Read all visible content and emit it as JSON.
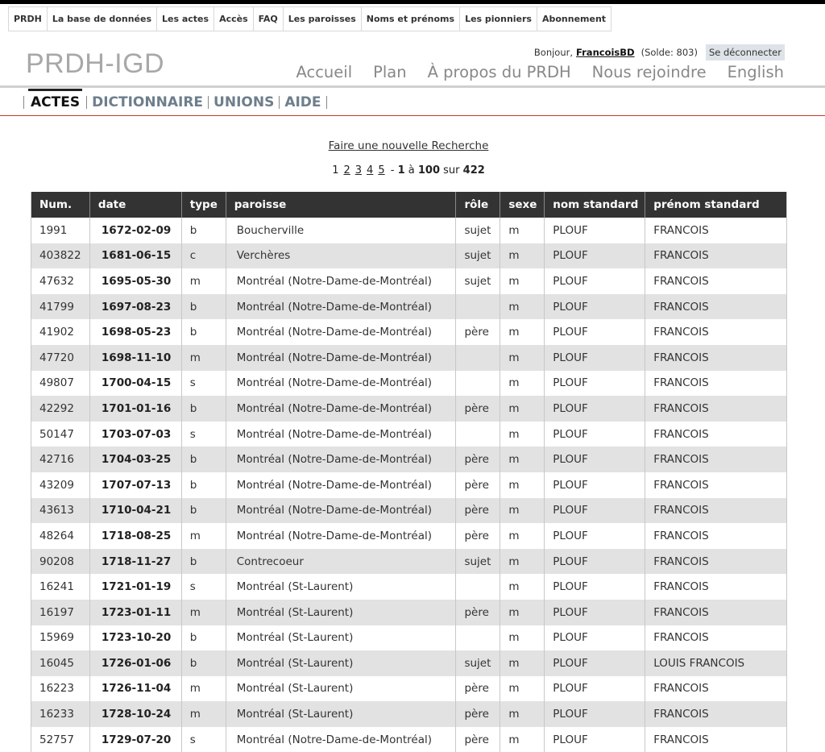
{
  "topnav": [
    "PRDH",
    "La base de données",
    "Les actes",
    "Accès",
    "FAQ",
    "Les paroisses",
    "Noms et prénoms",
    "Les pionniers",
    "Abonnement"
  ],
  "logo": "PRDH-IGD",
  "user": {
    "greeting": "Bonjour,",
    "username": "FrancoisBD",
    "balance": "(Solde: 803)",
    "logout": "Se déconnecter"
  },
  "mainnav": [
    "Accueil",
    "Plan",
    "À propos du PRDH",
    "Nous rejoindre",
    "English"
  ],
  "subnav": [
    "ACTES",
    "DICTIONNAIRE",
    "UNIONS",
    "AIDE"
  ],
  "search": {
    "new_search": "Faire une nouvelle Recherche"
  },
  "pager": {
    "current": "1",
    "pages": [
      "2",
      "3",
      "4",
      "5"
    ],
    "dash": "-",
    "from": "1",
    "a": "à",
    "to": "100",
    "sur": "sur",
    "total": "422"
  },
  "table": {
    "headers": [
      "Num.",
      "date",
      "type",
      "paroisse",
      "rôle",
      "sexe",
      "nom standard",
      "prénom standard"
    ],
    "rows": [
      [
        "1991",
        "1672-02-09",
        "b",
        "Boucherville",
        "sujet",
        "m",
        "PLOUF",
        "FRANCOIS"
      ],
      [
        "403822",
        "1681-06-15",
        "c",
        "Verchères",
        "sujet",
        "m",
        "PLOUF",
        "FRANCOIS"
      ],
      [
        "47632",
        "1695-05-30",
        "m",
        "Montréal (Notre-Dame-de-Montréal)",
        "sujet",
        "m",
        "PLOUF",
        "FRANCOIS"
      ],
      [
        "41799",
        "1697-08-23",
        "b",
        "Montréal (Notre-Dame-de-Montréal)",
        "",
        "m",
        "PLOUF",
        "FRANCOIS"
      ],
      [
        "41902",
        "1698-05-23",
        "b",
        "Montréal (Notre-Dame-de-Montréal)",
        "père",
        "m",
        "PLOUF",
        "FRANCOIS"
      ],
      [
        "47720",
        "1698-11-10",
        "m",
        "Montréal (Notre-Dame-de-Montréal)",
        "",
        "m",
        "PLOUF",
        "FRANCOIS"
      ],
      [
        "49807",
        "1700-04-15",
        "s",
        "Montréal (Notre-Dame-de-Montréal)",
        "",
        "m",
        "PLOUF",
        "FRANCOIS"
      ],
      [
        "42292",
        "1701-01-16",
        "b",
        "Montréal (Notre-Dame-de-Montréal)",
        "père",
        "m",
        "PLOUF",
        "FRANCOIS"
      ],
      [
        "50147",
        "1703-07-03",
        "s",
        "Montréal (Notre-Dame-de-Montréal)",
        "",
        "m",
        "PLOUF",
        "FRANCOIS"
      ],
      [
        "42716",
        "1704-03-25",
        "b",
        "Montréal (Notre-Dame-de-Montréal)",
        "père",
        "m",
        "PLOUF",
        "FRANCOIS"
      ],
      [
        "43209",
        "1707-07-13",
        "b",
        "Montréal (Notre-Dame-de-Montréal)",
        "père",
        "m",
        "PLOUF",
        "FRANCOIS"
      ],
      [
        "43613",
        "1710-04-21",
        "b",
        "Montréal (Notre-Dame-de-Montréal)",
        "père",
        "m",
        "PLOUF",
        "FRANCOIS"
      ],
      [
        "48264",
        "1718-08-25",
        "m",
        "Montréal (Notre-Dame-de-Montréal)",
        "père",
        "m",
        "PLOUF",
        "FRANCOIS"
      ],
      [
        "90208",
        "1718-11-27",
        "b",
        "Contrecoeur",
        "sujet",
        "m",
        "PLOUF",
        "FRANCOIS"
      ],
      [
        "16241",
        "1721-01-19",
        "s",
        "Montréal (St-Laurent)",
        "",
        "m",
        "PLOUF",
        "FRANCOIS"
      ],
      [
        "16197",
        "1723-01-11",
        "m",
        "Montréal (St-Laurent)",
        "père",
        "m",
        "PLOUF",
        "FRANCOIS"
      ],
      [
        "15969",
        "1723-10-20",
        "b",
        "Montréal (St-Laurent)",
        "",
        "m",
        "PLOUF",
        "FRANCOIS"
      ],
      [
        "16045",
        "1726-01-06",
        "b",
        "Montréal (St-Laurent)",
        "sujet",
        "m",
        "PLOUF",
        "LOUIS FRANCOIS"
      ],
      [
        "16223",
        "1726-11-04",
        "m",
        "Montréal (St-Laurent)",
        "père",
        "m",
        "PLOUF",
        "FRANCOIS"
      ],
      [
        "16233",
        "1728-10-24",
        "m",
        "Montréal (St-Laurent)",
        "père",
        "m",
        "PLOUF",
        "FRANCOIS"
      ],
      [
        "52757",
        "1729-07-20",
        "s",
        "Montréal (Notre-Dame-de-Montréal)",
        "père",
        "m",
        "PLOUF",
        "FRANCOIS"
      ]
    ]
  }
}
